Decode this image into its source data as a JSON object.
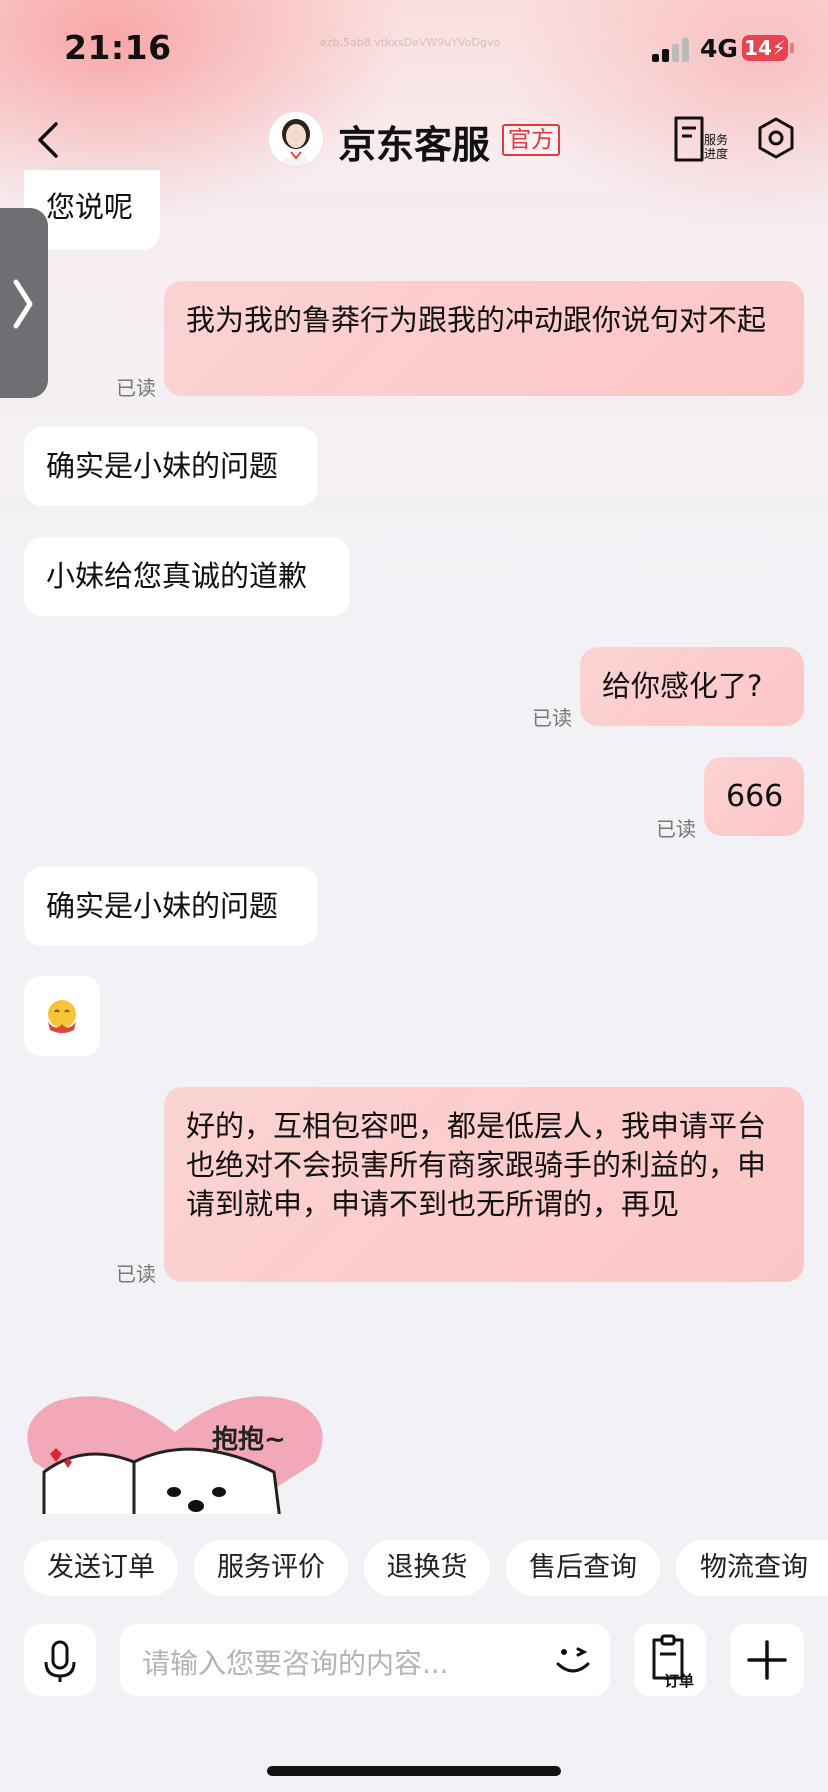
{
  "status": {
    "time": "21:16",
    "network": "4G",
    "battery": "14",
    "watermark": "ezb.5ab8.vtkxsDeVW9uYVoDgvo"
  },
  "nav": {
    "title": "京东客服",
    "badge": "官方",
    "service_label_1": "服务",
    "service_label_2": "进度"
  },
  "messages": {
    "m0": "您说呢",
    "m1": "我为我的鲁莽行为跟我的冲动跟你说句对不起",
    "m2": "确实是小妹的问题",
    "m3": "小妹给您真诚的道歉",
    "m4": "给你感化了?",
    "m5": "666",
    "m6": "确实是小妹的问题",
    "m8": "好的，互相包容吧，都是低层人，我申请平台也绝对不会损害所有商家跟骑手的利益的，申请到就申，申请不到也无所谓的，再见"
  },
  "read_label": "已读",
  "sticker": {
    "text": "抱抱~"
  },
  "quick_replies": [
    "发送订单",
    "服务评价",
    "退换货",
    "售后查询",
    "物流查询"
  ],
  "input": {
    "placeholder": "请输入您要咨询的内容...",
    "order_label": "订单"
  },
  "colors": {
    "accent": "#e33b3b",
    "bubble_right": "#fcc6c6",
    "bubble_left": "#ffffff"
  }
}
